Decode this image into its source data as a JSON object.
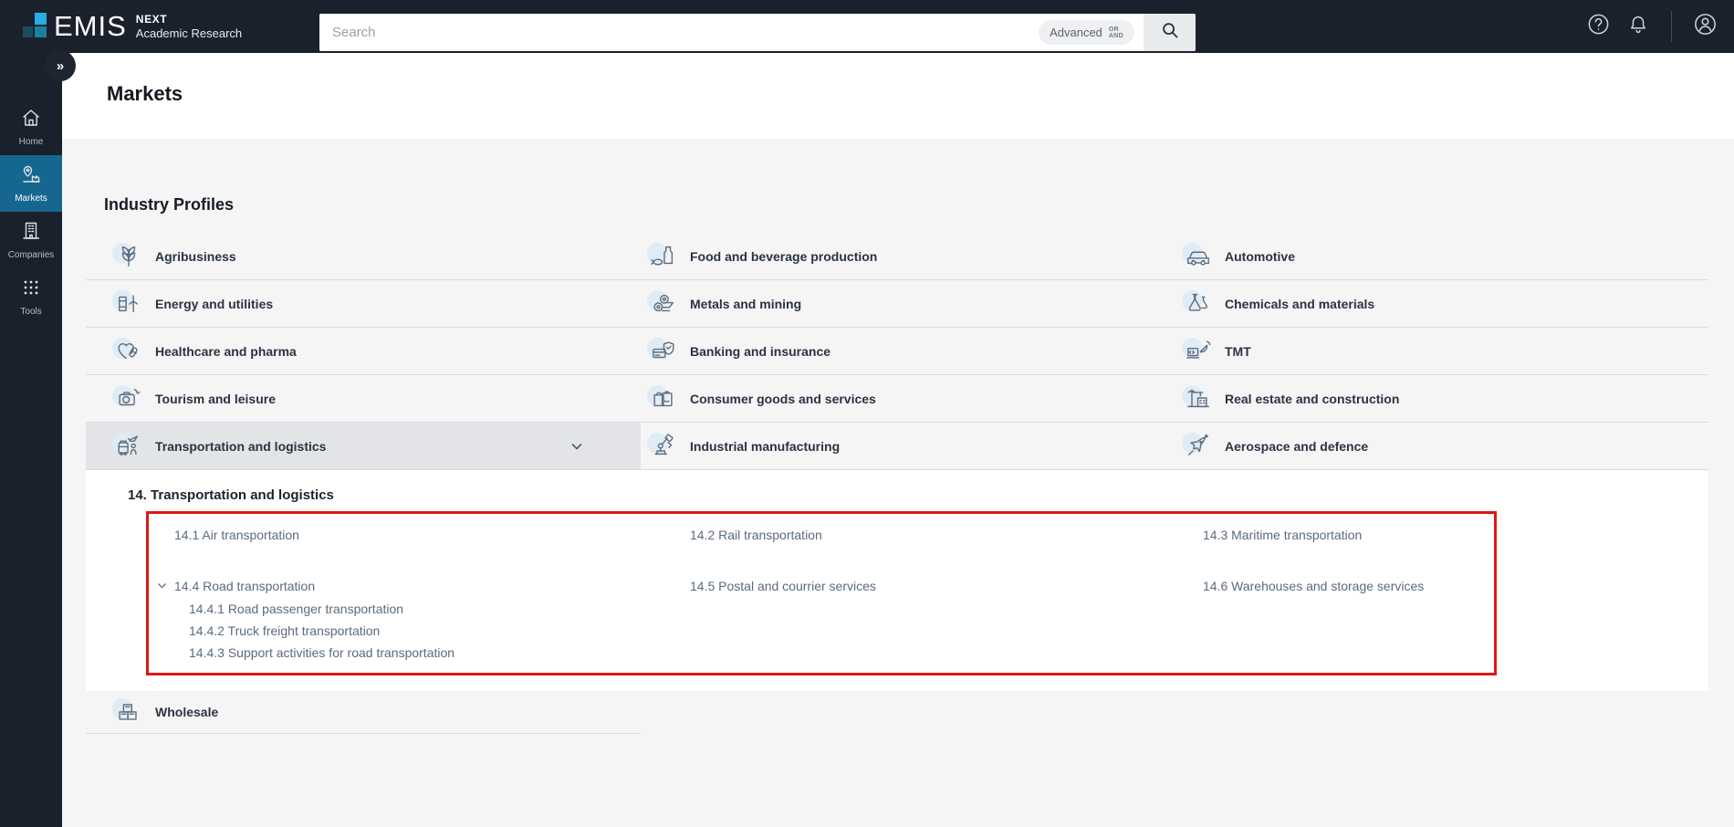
{
  "topbar": {
    "logo": {
      "brand": "EMIS",
      "product": "NEXT",
      "suite": "Academic Research"
    },
    "search": {
      "placeholder": "Search",
      "advanced_label": "Advanced",
      "advanced_or": "OR",
      "advanced_and": "AND"
    },
    "icons": {
      "help": "question-circle",
      "notifications": "bell",
      "account": "user-circle",
      "search": "magnifier"
    }
  },
  "sidebar": {
    "expand_glyph": "»",
    "items": [
      {
        "label": "Home",
        "icon": "home",
        "active": false
      },
      {
        "label": "Markets",
        "icon": "markets-pin-factory",
        "active": true
      },
      {
        "label": "Companies",
        "icon": "building",
        "active": false
      },
      {
        "label": "Tools",
        "icon": "grid-dots",
        "active": false
      }
    ]
  },
  "page": {
    "title": "Markets",
    "section_title": "Industry Profiles"
  },
  "industry_profiles": {
    "items": [
      {
        "label": "Agribusiness",
        "icon": "wheat"
      },
      {
        "label": "Food and beverage production",
        "icon": "bottle-fish"
      },
      {
        "label": "Automotive",
        "icon": "car"
      },
      {
        "label": "Energy and utilities",
        "icon": "barrel-turbine"
      },
      {
        "label": "Metals and mining",
        "icon": "metal-rolls"
      },
      {
        "label": "Chemicals and materials",
        "icon": "flasks"
      },
      {
        "label": "Healthcare and pharma",
        "icon": "heart-pill"
      },
      {
        "label": "Banking and insurance",
        "icon": "card-shield"
      },
      {
        "label": "TMT",
        "icon": "laptop-satellite"
      },
      {
        "label": "Tourism and leisure",
        "icon": "camera"
      },
      {
        "label": "Consumer goods and services",
        "icon": "shopping-bags"
      },
      {
        "label": "Real estate and construction",
        "icon": "crane-building"
      },
      {
        "label": "Transportation and logistics",
        "icon": "bus-plane",
        "selected": true,
        "expanded": true
      },
      {
        "label": "Industrial manufacturing",
        "icon": "robot-arm"
      },
      {
        "label": "Aerospace and defence",
        "icon": "fighter-jet"
      }
    ]
  },
  "expanded_section": {
    "heading": "14. Transportation and logistics",
    "row1": [
      "14.1 Air transportation",
      "14.2 Rail transportation",
      "14.3 Maritime transportation"
    ],
    "row2": [
      "14.4 Road transportation",
      "14.5 Postal and courrier services",
      "14.6 Warehouses and storage services"
    ],
    "road_children": [
      "14.4.1 Road passenger transportation",
      "14.4.2 Truck freight transportation",
      "14.4.3 Support activities for road transportation"
    ],
    "annotation": {
      "type": "red-box-highlight",
      "color": "#e01612"
    }
  },
  "wholesale": {
    "label": "Wholesale",
    "icon": "crates"
  },
  "colors": {
    "topbar_bg": "#1b212c",
    "sidebar_active": "#16678f",
    "brand_cyan": "#27aee5",
    "brand_teal": "#1b7fa0",
    "content_bg": "#f5f5f6",
    "selected_row_bg": "#e3e4e8",
    "row_border": "#d9dce3",
    "link_color": "#5a6b7d",
    "annotation_red": "#e01612"
  }
}
